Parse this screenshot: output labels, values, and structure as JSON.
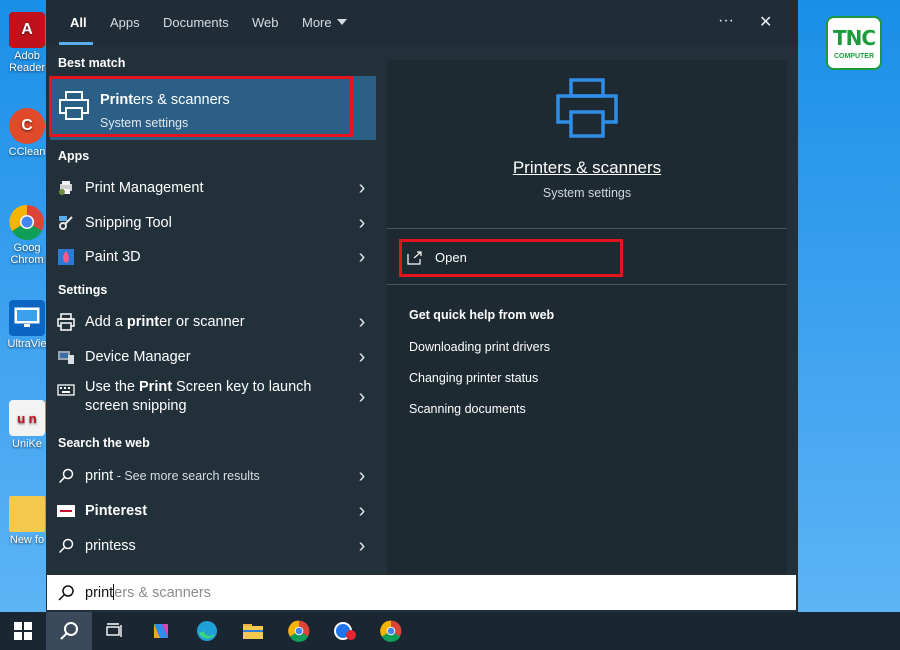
{
  "desktop": {
    "icons": [
      {
        "label": "Adob\nReader",
        "line1": "Adob",
        "line2": "Reader"
      },
      {
        "label": "CClean",
        "line1": "CClean"
      },
      {
        "label": "Goog\nChrom",
        "line1": "Goog",
        "line2": "Chrom"
      },
      {
        "label": "UltraVie",
        "line1": "UltraVie"
      },
      {
        "label": "UniKe",
        "line1": "UniKe"
      },
      {
        "label": "New fo",
        "line1": "New fo"
      }
    ],
    "logo": {
      "text": "TNC",
      "sub": "COMPUTER"
    }
  },
  "tabs": [
    {
      "label": "All"
    },
    {
      "label": "Apps"
    },
    {
      "label": "Documents"
    },
    {
      "label": "Web"
    },
    {
      "label": "More"
    }
  ],
  "topbar": {
    "more_options": "···",
    "close": "✕"
  },
  "sections": {
    "best_match": "Best match",
    "apps": "Apps",
    "settings": "Settings",
    "search_web": "Search the web"
  },
  "best_match": {
    "title_bold": "Print",
    "title_rest": "ers & scanners",
    "subtitle": "System settings"
  },
  "apps": [
    {
      "label": "Print Management",
      "icon": "print-management-icon"
    },
    {
      "label": "Snipping Tool",
      "icon": "snipping-tool-icon"
    },
    {
      "label": "Paint 3D",
      "icon": "paint-3d-icon"
    }
  ],
  "settings": [
    {
      "pre": "Add a ",
      "bold": "print",
      "post": "er or scanner",
      "icon": "printer-add-icon"
    },
    {
      "label": "Device Manager",
      "icon": "device-manager-icon"
    },
    {
      "line1_pre": "Use the ",
      "line1_bold": "Print",
      "line1_post": " Screen key to launch",
      "line2": "screen snipping",
      "icon": "keyboard-icon"
    }
  ],
  "web": [
    {
      "bold": "print",
      "rest": " - See more search results",
      "icon": "search-icon"
    },
    {
      "label": "Pinterest",
      "icon": "pinterest-icon"
    },
    {
      "label": "printess",
      "icon": "search-icon"
    }
  ],
  "preview": {
    "title": "Printers & scanners",
    "subtitle": "System settings",
    "open_label": "Open",
    "help_heading": "Get quick help from web",
    "links": [
      "Downloading print drivers",
      "Changing printer status",
      "Scanning documents"
    ]
  },
  "search": {
    "typed": "print",
    "suggestion": "ers & scanners"
  },
  "colors": {
    "accent": "#58aef5",
    "highlight_box": "#e3141b",
    "selected_bg": "#2c5f86",
    "panel_bg": "#22303a"
  }
}
